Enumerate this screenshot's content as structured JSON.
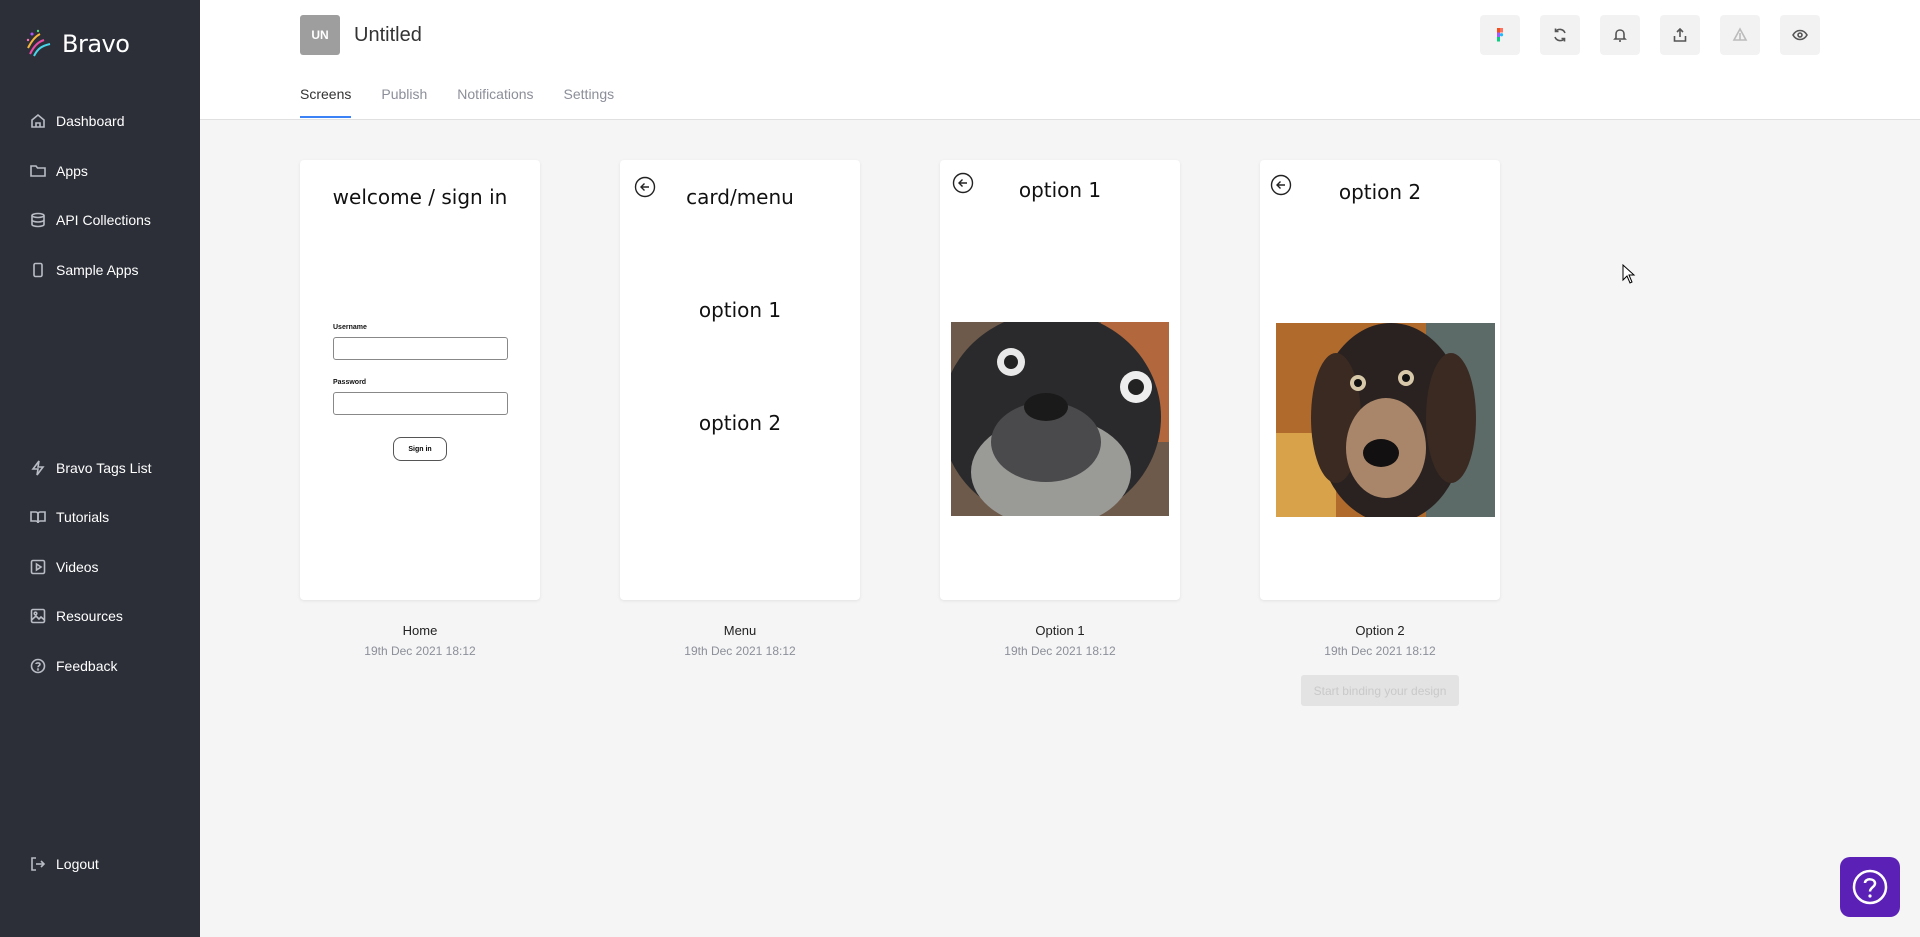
{
  "app": {
    "name": "Bravo"
  },
  "sidebar": {
    "items": [
      {
        "label": "Dashboard",
        "icon": "home-icon"
      },
      {
        "label": "Apps",
        "icon": "folder-icon"
      },
      {
        "label": "API Collections",
        "icon": "database-icon"
      },
      {
        "label": "Sample Apps",
        "icon": "phone-icon"
      },
      {
        "label": "Bravo Tags List",
        "icon": "bolt-icon"
      },
      {
        "label": "Tutorials",
        "icon": "book-icon"
      },
      {
        "label": "Videos",
        "icon": "play-icon"
      },
      {
        "label": "Resources",
        "icon": "image-icon"
      },
      {
        "label": "Feedback",
        "icon": "help-circle-icon"
      },
      {
        "label": "Logout",
        "icon": "logout-icon"
      }
    ]
  },
  "project": {
    "badge": "UN",
    "title": "Untitled"
  },
  "tabs": [
    {
      "label": "Screens",
      "active": true
    },
    {
      "label": "Publish",
      "active": false
    },
    {
      "label": "Notifications",
      "active": false
    },
    {
      "label": "Settings",
      "active": false
    }
  ],
  "toolbar": [
    "figma-icon",
    "sync-icon",
    "bell-icon",
    "share-icon",
    "deploy-icon",
    "eye-icon"
  ],
  "screens": [
    {
      "name": "Home",
      "date": "19th Dec 2021 18:12",
      "title": "welcome / sign in",
      "username_label": "Username",
      "password_label": "Password",
      "signin_label": "Sign in"
    },
    {
      "name": "Menu",
      "date": "19th Dec 2021 18:12",
      "title": "card/menu",
      "option1": "option 1",
      "option2": "option 2"
    },
    {
      "name": "Option 1",
      "date": "19th Dec 2021 18:12",
      "title": "option 1"
    },
    {
      "name": "Option 2",
      "date": "19th Dec 2021 18:12",
      "title": "option 2"
    }
  ],
  "tooltip": "Start binding your design",
  "colors": {
    "sidebar": "#2c2f38",
    "accent": "#3b82f6",
    "help": "#5b21b6"
  }
}
